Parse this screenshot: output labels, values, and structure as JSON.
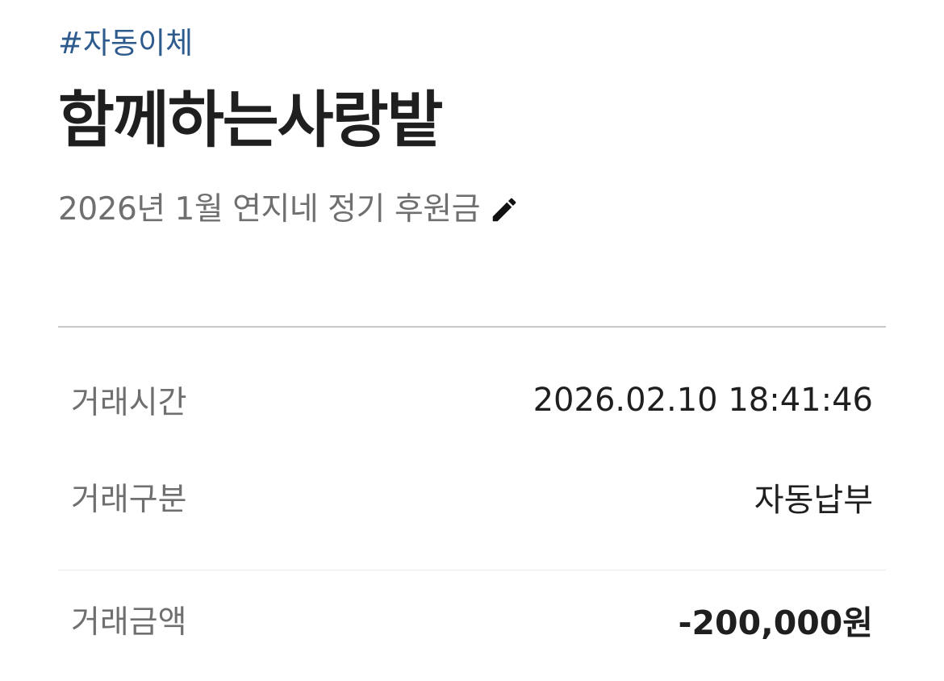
{
  "header": {
    "tag": "#자동이체",
    "title": "함께하는사랑밭",
    "memo": "2026년 1월 연지네 정기 후원금",
    "edit_icon": "pencil-icon"
  },
  "details": [
    {
      "label": "거래시간",
      "value": "2026.02.10 18:41:46"
    },
    {
      "label": "거래구분",
      "value": "자동납부"
    },
    {
      "label": "거래금액",
      "value": "-200,000원"
    }
  ],
  "colors": {
    "tag": "#2e5b8e",
    "title": "#1f1f1f",
    "muted": "#6f6f6f",
    "divider": "#c8c8c8"
  }
}
